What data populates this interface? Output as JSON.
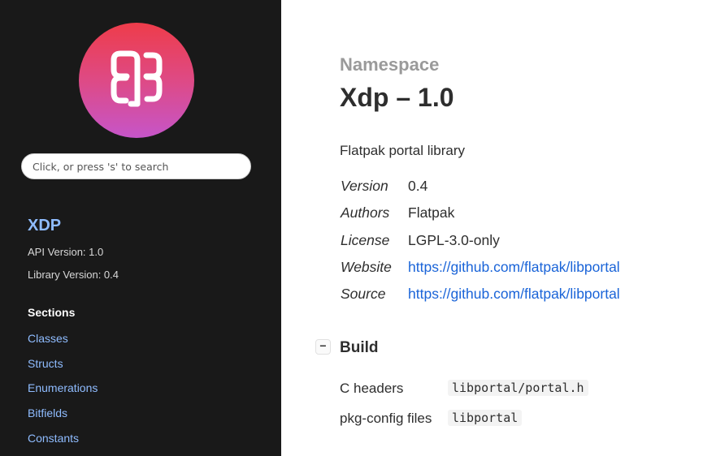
{
  "sidebar": {
    "logo_icon": "libportal-logo-icon",
    "search_placeholder": "Click, or press 's' to search",
    "namespace_link": "XDP",
    "api_version": "API Version: 1.0",
    "library_version": "Library Version: 0.4",
    "sections_title": "Sections",
    "sections": [
      {
        "label": "Classes"
      },
      {
        "label": "Structs"
      },
      {
        "label": "Enumerations"
      },
      {
        "label": "Bitfields"
      },
      {
        "label": "Constants"
      }
    ]
  },
  "main": {
    "kicker": "Namespace",
    "title": "Xdp – 1.0",
    "description": "Flatpak portal library",
    "properties": [
      {
        "key": "Version",
        "value": "0.4"
      },
      {
        "key": "Authors",
        "value": "Flatpak"
      },
      {
        "key": "License",
        "value": "LGPL-3.0-only"
      },
      {
        "key": "Website",
        "value": "https://github.com/flatpak/libportal"
      },
      {
        "key": "Source",
        "value": "https://github.com/flatpak/libportal"
      }
    ],
    "build": {
      "toggle_label": "−",
      "title": "Build",
      "rows": [
        {
          "key": "C headers",
          "value": "libportal/portal.h"
        },
        {
          "key": "pkg-config files",
          "value": "libportal"
        }
      ]
    }
  },
  "colors": {
    "sidebar_bg": "#191919",
    "link_sidebar": "#8fbcff",
    "link_main": "#1a64d8",
    "logo_gradient_top": "#ee3c4a",
    "logo_gradient_bottom": "#c655c9"
  }
}
